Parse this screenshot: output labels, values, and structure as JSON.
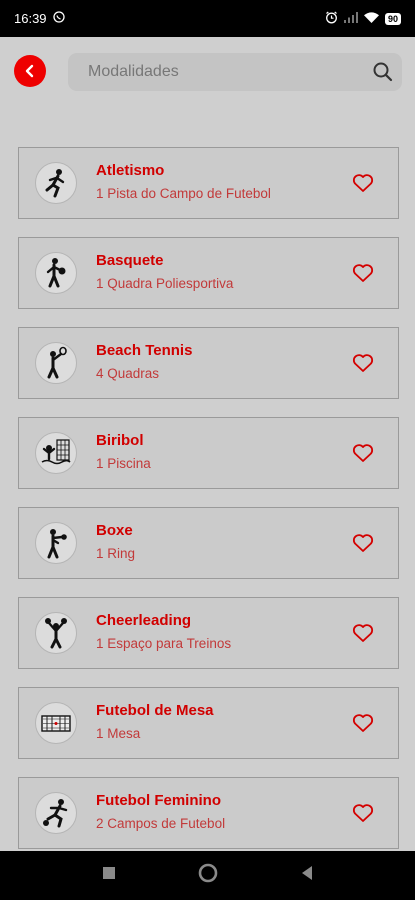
{
  "status_bar": {
    "time": "16:39",
    "battery": "90"
  },
  "search": {
    "placeholder": "Modalidades"
  },
  "sports": [
    {
      "title": "Atletismo",
      "subtitle": "1 Pista do Campo de Futebol",
      "icon": "running-icon"
    },
    {
      "title": "Basquete",
      "subtitle": "1 Quadra Poliesportiva",
      "icon": "basketball-icon"
    },
    {
      "title": "Beach Tennis",
      "subtitle": "4 Quadras",
      "icon": "tennis-icon"
    },
    {
      "title": "Biribol",
      "subtitle": "1 Piscina",
      "icon": "water-volleyball-icon"
    },
    {
      "title": "Boxe",
      "subtitle": "1 Ring",
      "icon": "boxing-icon"
    },
    {
      "title": "Cheerleading",
      "subtitle": "1 Espaço para Treinos",
      "icon": "cheerleading-icon"
    },
    {
      "title": "Futebol de Mesa",
      "subtitle": "1 Mesa",
      "icon": "table-football-icon"
    },
    {
      "title": "Futebol Feminino",
      "subtitle": "2 Campos de Futebol",
      "icon": "soccer-icon"
    }
  ],
  "colors": {
    "accent": "#dd0000",
    "background": "#cfcfcf"
  }
}
